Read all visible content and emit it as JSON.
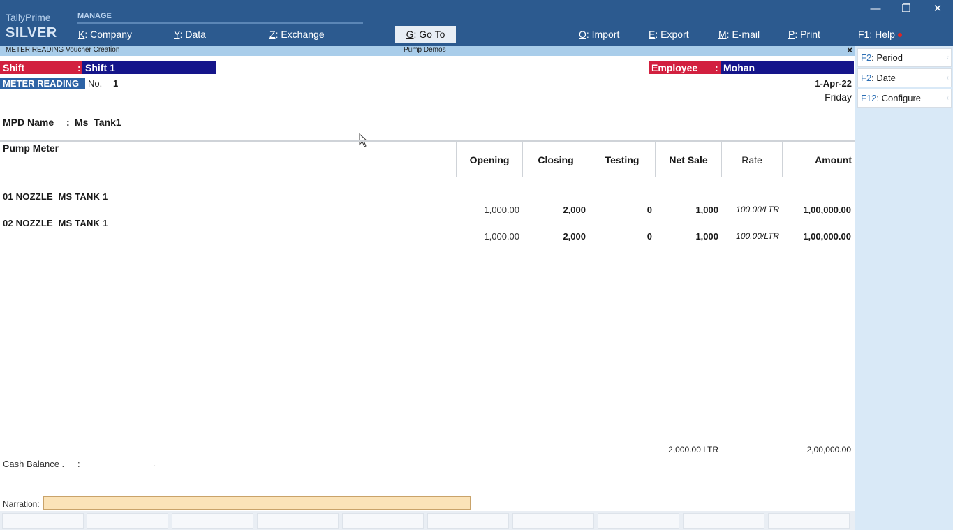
{
  "topbar": {
    "brand_name": "TallyPrime",
    "brand_edition": "SILVER",
    "manage_label": "MANAGE",
    "menu": [
      {
        "key": "K",
        "label": ": Company"
      },
      {
        "key": "Y",
        "label": ": Data"
      },
      {
        "key": "Z",
        "label": ": Exchange"
      },
      {
        "key": "G",
        "label": ": Go To"
      },
      {
        "key": "O",
        "label": ": Import"
      },
      {
        "key": "E",
        "label": ": Export"
      },
      {
        "key": "M",
        "label": ": E-mail"
      },
      {
        "key": "P",
        "label": ": Print"
      },
      {
        "key": "F1",
        "label": ": Help"
      }
    ],
    "window_controls": {
      "minimize": "—",
      "restore": "❐",
      "close": "✕"
    }
  },
  "subheader": {
    "voucher_title": "METER READING Voucher Creation",
    "company_title": "Pump Demos",
    "close": "×"
  },
  "side_panel": [
    {
      "key": "F2",
      "label": ": Period"
    },
    {
      "key": "F2",
      "label": ": Date"
    },
    {
      "key": "F12",
      "label": ": Configure"
    }
  ],
  "form": {
    "shift_label": "Shift",
    "shift_sep": ":",
    "shift_value": "Shift 1",
    "employee_label": "Employee",
    "employee_sep": ":",
    "employee_value": "Mohan",
    "voucher_type": "METER READING",
    "no_label": "No.",
    "no_value": "1",
    "date": "1-Apr-22",
    "day": "Friday",
    "mpd_label": "MPD Name",
    "mpd_sep": ":",
    "mpd_value": "Ms  Tank1"
  },
  "table": {
    "headers": {
      "pump_meter": "Pump Meter",
      "opening": "Opening",
      "closing": "Closing",
      "testing": "Testing",
      "net_sale": "Net Sale",
      "rate": "Rate",
      "amount": "Amount"
    },
    "rows": [
      {
        "name": "01 NOZZLE  MS TANK 1",
        "opening": "1,000.00",
        "closing": "2,000",
        "testing": "0",
        "net_sale": "1,000",
        "rate": "100.00/LTR",
        "amount": "1,00,000.00"
      },
      {
        "name": "02 NOZZLE  MS TANK 1",
        "opening": "1,000.00",
        "closing": "2,000",
        "testing": "0",
        "net_sale": "1,000",
        "rate": "100.00/LTR",
        "amount": "1,00,000.00"
      }
    ],
    "totals": {
      "net_sale": "2,000.00 LTR",
      "amount": "2,00,000.00"
    }
  },
  "footer": {
    "cash_balance_label": "Cash Balance .",
    "cash_balance_sep": ":",
    "cash_balance_value": ".",
    "narration_label": "Narration:",
    "narration_value": ""
  }
}
